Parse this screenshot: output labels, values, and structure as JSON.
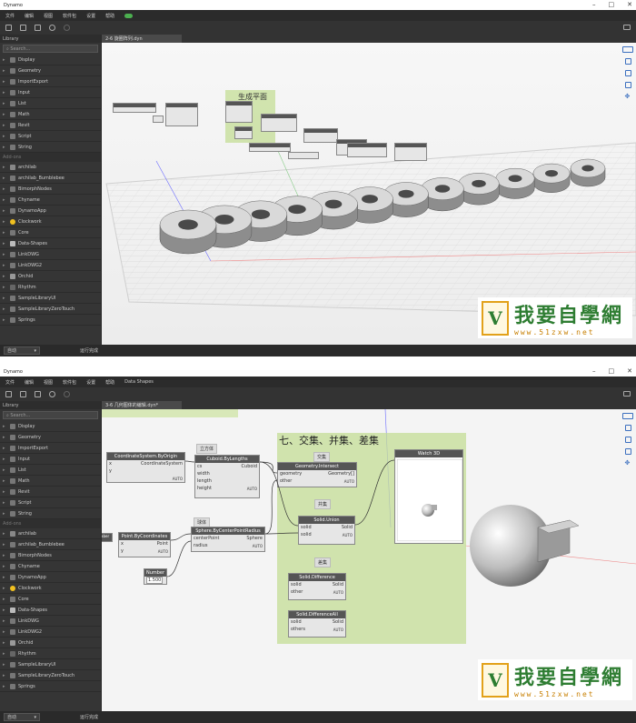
{
  "app": {
    "title": "Dynamo",
    "minimize": "–",
    "maximize": "□",
    "close": "✕"
  },
  "menu": [
    "文件",
    "编辑",
    "视图",
    "软件包",
    "设置",
    "帮助"
  ],
  "menu_extra": "Data Shapes",
  "library": {
    "title": "Library",
    "search_placeholder": "Search...",
    "categories": [
      "Display",
      "Geometry",
      "ImportExport",
      "Input",
      "List",
      "Math",
      "Revit",
      "Script",
      "String"
    ],
    "addons_label": "Add-ons",
    "addons": [
      "archilab",
      "archilab_Bumblebee",
      "BimorphNodes",
      "Chyname",
      "DynamoApp",
      "Clockwork",
      "Core",
      "Data-Shapes",
      "LinkDWG",
      "LinkDWG2",
      "Orchid",
      "Rhythm",
      "SampleLibraryUI",
      "SampleLibraryZeroTouch",
      "Springs"
    ]
  },
  "status": {
    "run_mode": "自动",
    "run_status": "运行完成"
  },
  "screen1": {
    "tab": "2-6 旋圈阵列.dyn",
    "group_title": "生成平面"
  },
  "screen2": {
    "tab": "3-6 几何图体的编辑.dyn*",
    "group_title": "七、交集、并集、差集",
    "nodes": {
      "csbo": {
        "title": "CoordinateSystem.ByOrigin",
        "in": [
          "x",
          "y"
        ],
        "out": "CoordinateSystem",
        "lacing": "AUTO"
      },
      "cbl": {
        "title": "Cuboid.ByLengths",
        "in": [
          "cs",
          "width",
          "length",
          "height"
        ],
        "out": "Cuboid",
        "lacing": "AUTO"
      },
      "pbc": {
        "title": "Point.ByCoordinates",
        "in": [
          "x",
          "y"
        ],
        "out": "Point",
        "lacing": "AUTO"
      },
      "sbcpr": {
        "title": "Sphere.ByCenterPointRadius",
        "in": [
          "centerPoint",
          "radius"
        ],
        "out": "Sphere",
        "lacing": "AUTO"
      },
      "num": {
        "title": "Number",
        "value": "1.500"
      },
      "gi": {
        "title": "Geometry.Intersect",
        "in": [
          "geometry",
          "other"
        ],
        "out": "Geometry[]",
        "lacing": "AUTO"
      },
      "su": {
        "title": "Solid.Union",
        "in": [
          "solid",
          "solid"
        ],
        "out": "Solid",
        "lacing": "AUTO"
      },
      "sd": {
        "title": "Solid.Difference",
        "in": [
          "solid",
          "other"
        ],
        "out": "Solid",
        "lacing": "AUTO"
      },
      "sda": {
        "title": "Solid.DifferenceAll",
        "in": [
          "solid",
          "others"
        ],
        "out": "Solid",
        "lacing": "AUTO"
      },
      "w3d": {
        "title": "Watch 3D"
      }
    },
    "notes": {
      "cube": "立方体",
      "sphere": "球体",
      "intersect": "交集",
      "union": "并集",
      "diff": "差集"
    },
    "slider_label": "aber"
  },
  "watermark": {
    "logo": "V",
    "cn": "我要自學網",
    "url": "www.51zxw.net"
  }
}
